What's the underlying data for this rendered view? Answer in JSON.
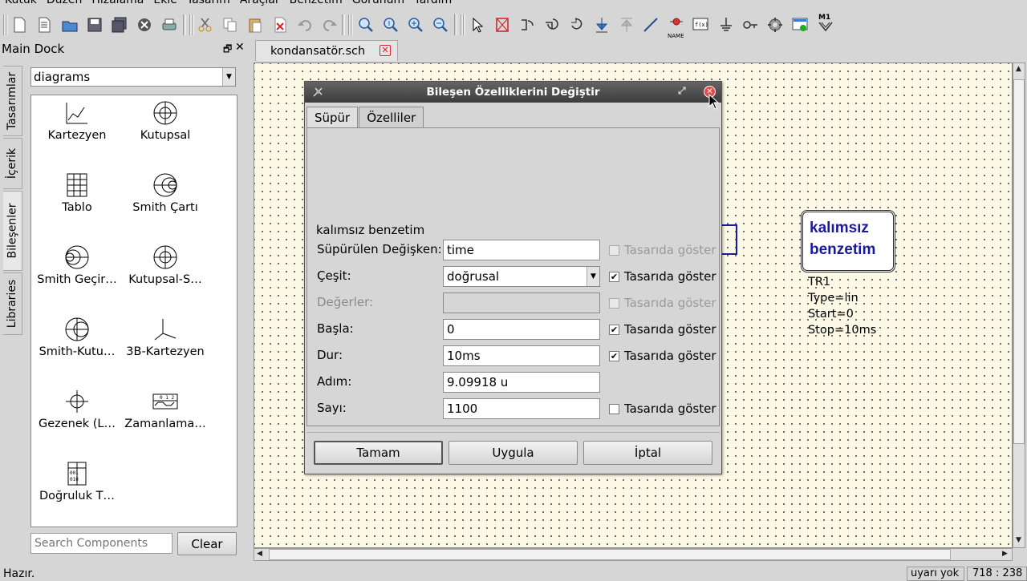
{
  "menu": [
    "Kütük",
    "Düzen",
    "Hizalama",
    "Ekle",
    "Tasarım",
    "Araçlar",
    "Benzetim",
    "Görünüm",
    "Yardım"
  ],
  "toolbar": {
    "icons": [
      "new-icon",
      "new-text-icon",
      "open-icon",
      "save-icon",
      "save-all-icon",
      "close-doc-icon",
      "print-icon",
      "cut-icon",
      "copy-icon",
      "paste-icon",
      "delete-icon",
      "undo-icon",
      "redo-icon",
      "zoom-fit-icon",
      "zoom-1-icon",
      "zoom-in-icon",
      "zoom-out-icon",
      "select-icon",
      "deactivate-icon",
      "rotate-ccw-icon",
      "rotate-cw-icon",
      "mirror-x-icon",
      "mirror-y-icon",
      "go-up-icon",
      "wire-icon",
      "label-name-icon",
      "equation-icon",
      "ground-icon",
      "port-icon",
      "simulate-icon",
      "dpl-icon",
      "marker-icon"
    ],
    "name_label": "NAME",
    "m1_label": "M1"
  },
  "vtabs": [
    "Tasarımlar",
    "İçerik",
    "Bileşenler",
    "Libraries"
  ],
  "dock": {
    "title": "Main Dock",
    "float_glyph": "🗗",
    "close_glyph": "✕",
    "category": "diagrams",
    "items": [
      {
        "label": "Kartezyen",
        "icon": "cartesian-icon"
      },
      {
        "label": "Kutupsal",
        "icon": "polar-icon"
      },
      {
        "label": "Tablo",
        "icon": "table-icon"
      },
      {
        "label": "Smith Çartı",
        "icon": "smith-icon"
      },
      {
        "label": "Smith Geçir…",
        "icon": "smith-admittance-icon"
      },
      {
        "label": "Kutupsal-S…",
        "icon": "polar-smith-icon"
      },
      {
        "label": "Smith-Kutu…",
        "icon": "smith-polar-icon"
      },
      {
        "label": "3B-Kartezyen",
        "icon": "cartesian-3d-icon"
      },
      {
        "label": "Gezenek (L…",
        "icon": "locus-icon"
      },
      {
        "label": "Zamanlama…",
        "icon": "timing-icon"
      },
      {
        "label": "Doğruluk T…",
        "icon": "truth-table-icon"
      }
    ],
    "search_placeholder": "Search Components",
    "clear_label": "Clear"
  },
  "document": {
    "tab_label": "kondansatör.sch",
    "tab_close_glyph": "✕"
  },
  "canvas": {
    "sim_title_1": "kalımsız",
    "sim_title_2": "benzetim",
    "props": [
      "TR1",
      "Type=lin",
      "Start=0",
      "Stop=10ms"
    ]
  },
  "dialog": {
    "title": "Bileşen Özelliklerini Değiştir",
    "restore_glyph": "⤢",
    "close_glyph": "✕",
    "tabs": [
      "Süpür",
      "Özelliler"
    ],
    "active_tab": 0,
    "sim_type": "kalımsız benzetim",
    "fields": [
      {
        "label": "Süpürülen Değişken:",
        "value": "time",
        "kind": "input",
        "show": "Tasarıda göster",
        "checked": false,
        "check_enabled": false,
        "enabled": true
      },
      {
        "label": "Çeşit:",
        "value": "doğrusal",
        "kind": "select",
        "show": "Tasarıda göster",
        "checked": true,
        "check_enabled": true,
        "enabled": true
      },
      {
        "label": "Değerler:",
        "value": "",
        "kind": "input",
        "show": "Tasarıda göster",
        "checked": false,
        "check_enabled": false,
        "enabled": false
      },
      {
        "label": "Başla:",
        "value": "0",
        "kind": "input",
        "show": "Tasarıda göster",
        "checked": true,
        "check_enabled": true,
        "enabled": true
      },
      {
        "label": "Dur:",
        "value": "10ms",
        "kind": "input",
        "show": "Tasarıda göster",
        "checked": true,
        "check_enabled": true,
        "enabled": true
      },
      {
        "label": "Adım:",
        "value": "9.09918 u",
        "kind": "input",
        "show": "",
        "checked": false,
        "check_enabled": true,
        "enabled": true
      },
      {
        "label": "Sayı:",
        "value": "1100",
        "kind": "input",
        "show": "Tasarıda göster",
        "checked": false,
        "check_enabled": true,
        "enabled": true
      }
    ],
    "buttons": {
      "ok": "Tamam",
      "apply": "Uygula",
      "cancel": "İptal"
    }
  },
  "status": {
    "text": "Hazır.",
    "warnings": "uyarı yok",
    "coords": "718 : 238"
  },
  "colors": {
    "canvas_bg": "#fbf8e6",
    "sim_text": "#1a1a9a",
    "close_red": "#e04b4b"
  }
}
